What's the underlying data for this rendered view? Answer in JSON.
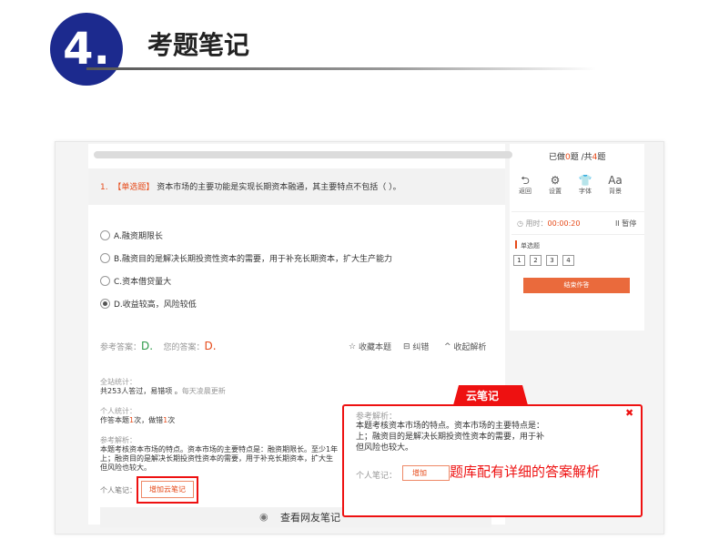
{
  "header": {
    "number": "4.",
    "title": "考题笔记"
  },
  "top": {
    "done_prefix": "已做",
    "done_count": "0",
    "done_mid": "题 /共",
    "total_count": "4",
    "total_suffix": "题"
  },
  "question": {
    "number": "1.",
    "type": "【单选题】",
    "text": "资本市场的主要功能是实现长期资本融通，其主要特点不包括（    ）。",
    "options": [
      "A.融资期限长",
      "B.融资目的是解决长期投资性资本的需要，用于补充长期资本，扩大生产能力",
      "C.资本借贷量大",
      "D.收益较高，风险较低"
    ],
    "selected_index": 3
  },
  "answer": {
    "ref_label": "参考答案：",
    "ref_value": "D.",
    "your_label": "您的答案：",
    "your_value": "D."
  },
  "tools": {
    "collect": "收藏本题",
    "report": "纠错",
    "collapse": "收起解析"
  },
  "stats": {
    "site_label": "全站统计：",
    "site_text": "共253人答过，易错项 。",
    "site_note": "每天凌晨更新",
    "personal_label": "个人统计：",
    "personal_a": "作答本题",
    "personal_count1": "1",
    "personal_b": "次，做错",
    "personal_count2": "1",
    "personal_c": "次"
  },
  "analysis": {
    "label": "参考解析：",
    "line1": "本题考核资本市场的特点。资本市场的主要特点是：融资期限长。至少1年",
    "line2": "上；融资目的是解决长期投资性资本的需要，用于补充长期资本，扩大生",
    "line3": "但风险也较大。"
  },
  "note": {
    "label": "个人笔记：",
    "add_button": "增加云笔记"
  },
  "peer_notes": "查看网友笔记",
  "side": {
    "tools": [
      {
        "icon": "undo-icon",
        "glyph": "⮌",
        "label": "返回"
      },
      {
        "icon": "gear-icon",
        "glyph": "⚙",
        "label": "设置"
      },
      {
        "icon": "shirt-icon",
        "glyph": "👕",
        "label": "字体"
      },
      {
        "icon": "font-size-icon",
        "glyph": "Aa",
        "label": "背景"
      }
    ],
    "timer_label": "用时：",
    "timer_value": "00:00:20",
    "pause": "II 暂停",
    "qtype": "单选题",
    "qnums": [
      "1",
      "2",
      "3",
      "4"
    ],
    "submit": "结束作答"
  },
  "popup": {
    "tab": "云笔记",
    "label": "参考解析：",
    "line1": "本题考核资本市场的特点。资本市场的主要特点是：",
    "line2": "上；融资目的是解决长期投资性资本的需要，用于补",
    "line3": "但风险也较大。",
    "note_label": "个人笔记：",
    "add_button": "增加"
  },
  "callout": "题库配有详细的答案解析",
  "colors": {
    "accent": "#e64a19",
    "brand": "#1c2a8e",
    "highlight": "#e11111",
    "submit": "#ea6a3c"
  }
}
